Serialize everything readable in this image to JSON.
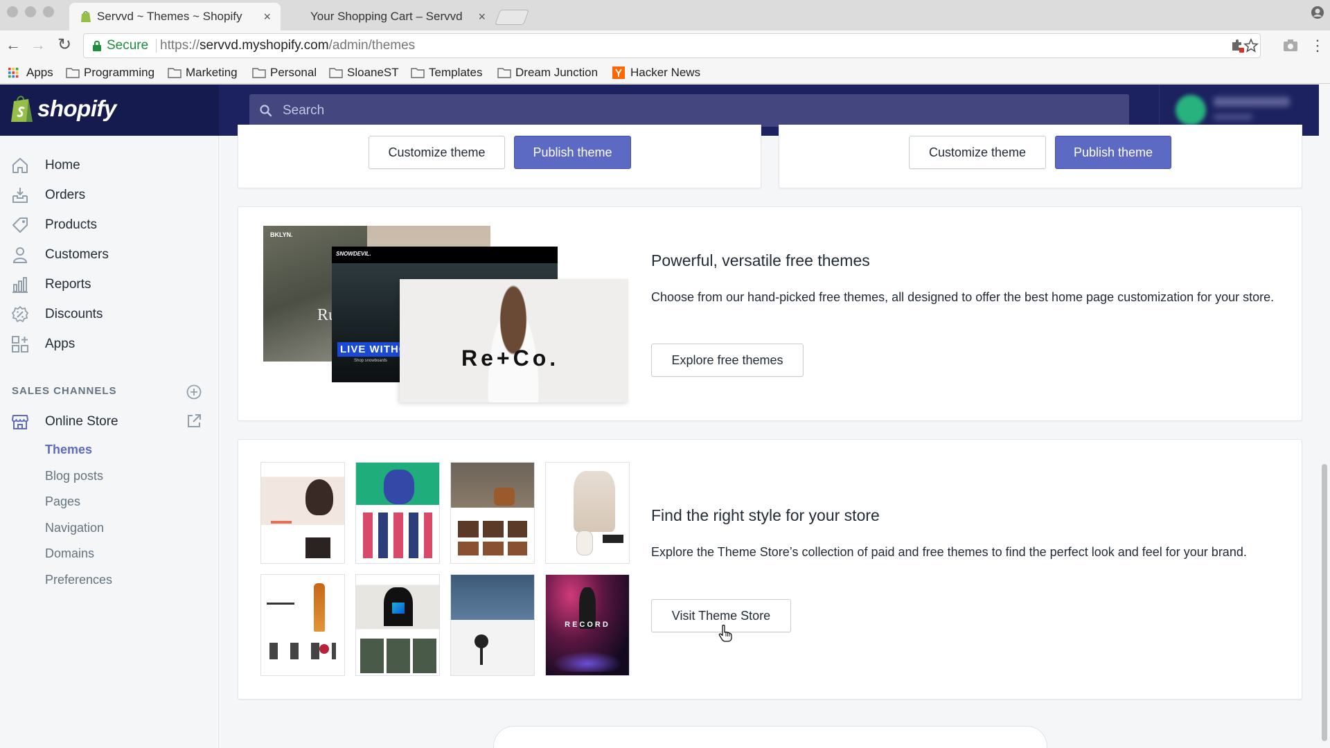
{
  "browser": {
    "tabs": [
      {
        "title": "Servvd ~ Themes ~ Shopify",
        "active": true
      },
      {
        "title": "Your Shopping Cart – Servvd",
        "active": false
      }
    ],
    "close_glyph": "×",
    "address": {
      "secure_label": "Secure",
      "scheme": "https://",
      "host": "servvd.myshopify.com",
      "path": "/admin/themes"
    },
    "bookmarks": [
      {
        "label": "Apps",
        "icon": "apps-grid-icon"
      },
      {
        "label": "Programming",
        "icon": "folder-icon"
      },
      {
        "label": "Marketing",
        "icon": "folder-icon"
      },
      {
        "label": "Personal",
        "icon": "folder-icon"
      },
      {
        "label": "SloaneST",
        "icon": "folder-icon"
      },
      {
        "label": "Templates",
        "icon": "folder-icon"
      },
      {
        "label": "Dream Junction",
        "icon": "folder-icon"
      },
      {
        "label": "Hacker News",
        "icon": "hacker-news-icon"
      }
    ]
  },
  "topbar": {
    "brand": "shopify",
    "search_placeholder": "Search"
  },
  "sidebar": {
    "items": [
      {
        "label": "Home",
        "icon": "home-icon"
      },
      {
        "label": "Orders",
        "icon": "orders-icon"
      },
      {
        "label": "Products",
        "icon": "tag-icon"
      },
      {
        "label": "Customers",
        "icon": "person-icon"
      },
      {
        "label": "Reports",
        "icon": "bar-chart-icon"
      },
      {
        "label": "Discounts",
        "icon": "discount-icon"
      },
      {
        "label": "Apps",
        "icon": "apps-icon"
      }
    ],
    "sales_channels_heading": "SALES CHANNELS",
    "online_store": "Online Store",
    "sub_items": [
      "Themes",
      "Blog posts",
      "Pages",
      "Navigation",
      "Domains",
      "Preferences"
    ],
    "active_sub_item": "Themes"
  },
  "main": {
    "theme_cards": [
      {
        "customize_label": "Customize theme",
        "publish_label": "Publish theme"
      },
      {
        "customize_label": "Customize theme",
        "publish_label": "Publish theme"
      }
    ],
    "free_themes": {
      "title": "Powerful, versatile free themes",
      "description": "Choose from our hand-picked free themes, all designed to offer the best home page customization for your store.",
      "button": "Explore free themes",
      "mockups": {
        "back_name": "BKLYN.",
        "back_text": "Ru",
        "mid_name": "SNOWDEVIL.",
        "mid_banner": "LIVE WITHOU",
        "mid_sub": "Shop snowboards",
        "front_logo": "Re+Co."
      }
    },
    "theme_store": {
      "title": "Find the right style for your store",
      "description": "Explore the Theme Store’s collection of paid and free themes to find the perfect look and feel for your brand.",
      "button": "Visit Theme Store",
      "thumb_record_text": "RECORD"
    }
  },
  "colors": {
    "accent": "#5c6ac4",
    "topbar": "#1c2260",
    "brand_area": "#161b4f",
    "search_bg": "#43467f",
    "secure_green": "#1e8e3e",
    "shopify_green": "#95bf47"
  }
}
